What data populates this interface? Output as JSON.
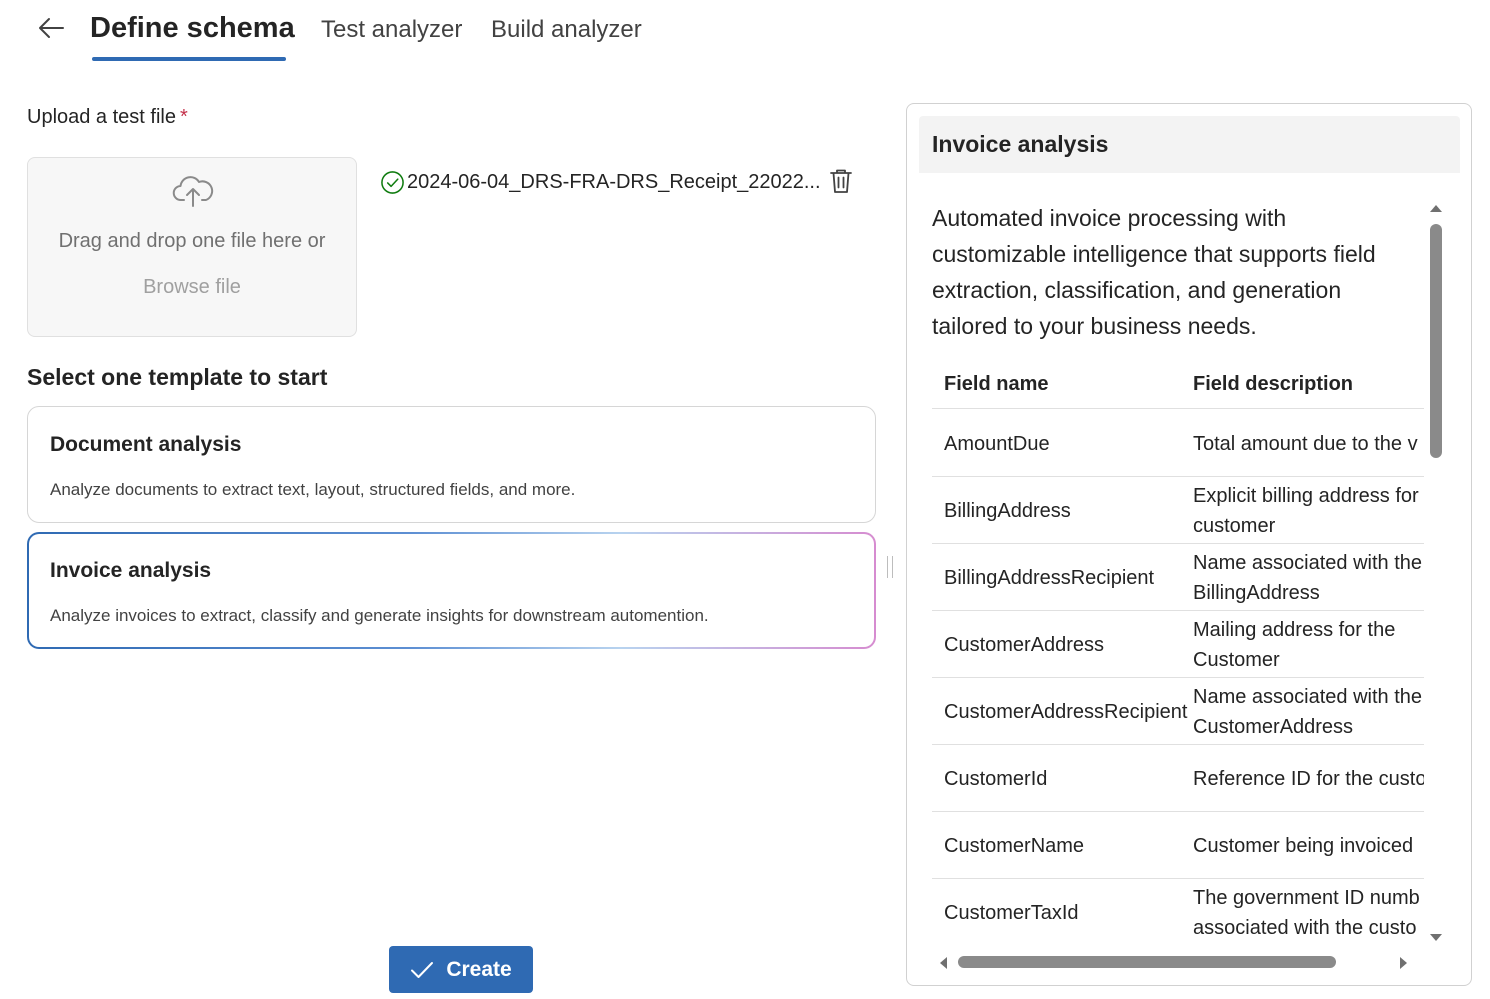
{
  "header": {
    "tabs": [
      {
        "label": "Define schema",
        "active": true
      },
      {
        "label": "Test analyzer",
        "active": false
      },
      {
        "label": "Build analyzer",
        "active": false
      }
    ]
  },
  "upload": {
    "label": "Upload a test file",
    "required_mark": "*",
    "drop_text": "Drag and drop one file here or",
    "browse_text": "Browse file",
    "file_name": "2024-06-04_DRS-FRA-DRS_Receipt_22022..."
  },
  "templates": {
    "title": "Select one template to start",
    "cards": [
      {
        "title": "Document analysis",
        "description": "Analyze documents to extract text, layout, structured fields, and more.",
        "selected": false
      },
      {
        "title": "Invoice analysis",
        "description": "Analyze invoices to extract, classify and generate insights for downstream automention.",
        "selected": true
      }
    ]
  },
  "create_button": {
    "label": "Create"
  },
  "panel": {
    "title": "Invoice analysis",
    "description": "Automated invoice processing with customizable intelligence that supports field extraction, classification, and generation tailored to your business needs.",
    "columns": [
      "Field name",
      "Field description"
    ],
    "rows": [
      {
        "name": "AmountDue",
        "desc": "Total amount due to the v"
      },
      {
        "name": "BillingAddress",
        "desc": "Explicit billing address for customer"
      },
      {
        "name": "BillingAddressRecipient",
        "desc": "Name associated with the BillingAddress"
      },
      {
        "name": "CustomerAddress",
        "desc": "Mailing address for the Customer"
      },
      {
        "name": "CustomerAddressRecipient",
        "desc": "Name associated with the CustomerAddress"
      },
      {
        "name": "CustomerId",
        "desc": "Reference ID for the custo"
      },
      {
        "name": "CustomerName",
        "desc": "Customer being invoiced"
      },
      {
        "name": "CustomerTaxId",
        "desc": "The government ID numb associated with the custo"
      }
    ]
  },
  "colors": {
    "accent": "#2f6ab3",
    "required": "#c4314b",
    "success": "#107c10",
    "gradient_end": "#d68cd0"
  },
  "icons": [
    "back-arrow-icon",
    "cloud-upload-icon",
    "check-circle-icon",
    "trash-icon",
    "checkmark-icon"
  ]
}
